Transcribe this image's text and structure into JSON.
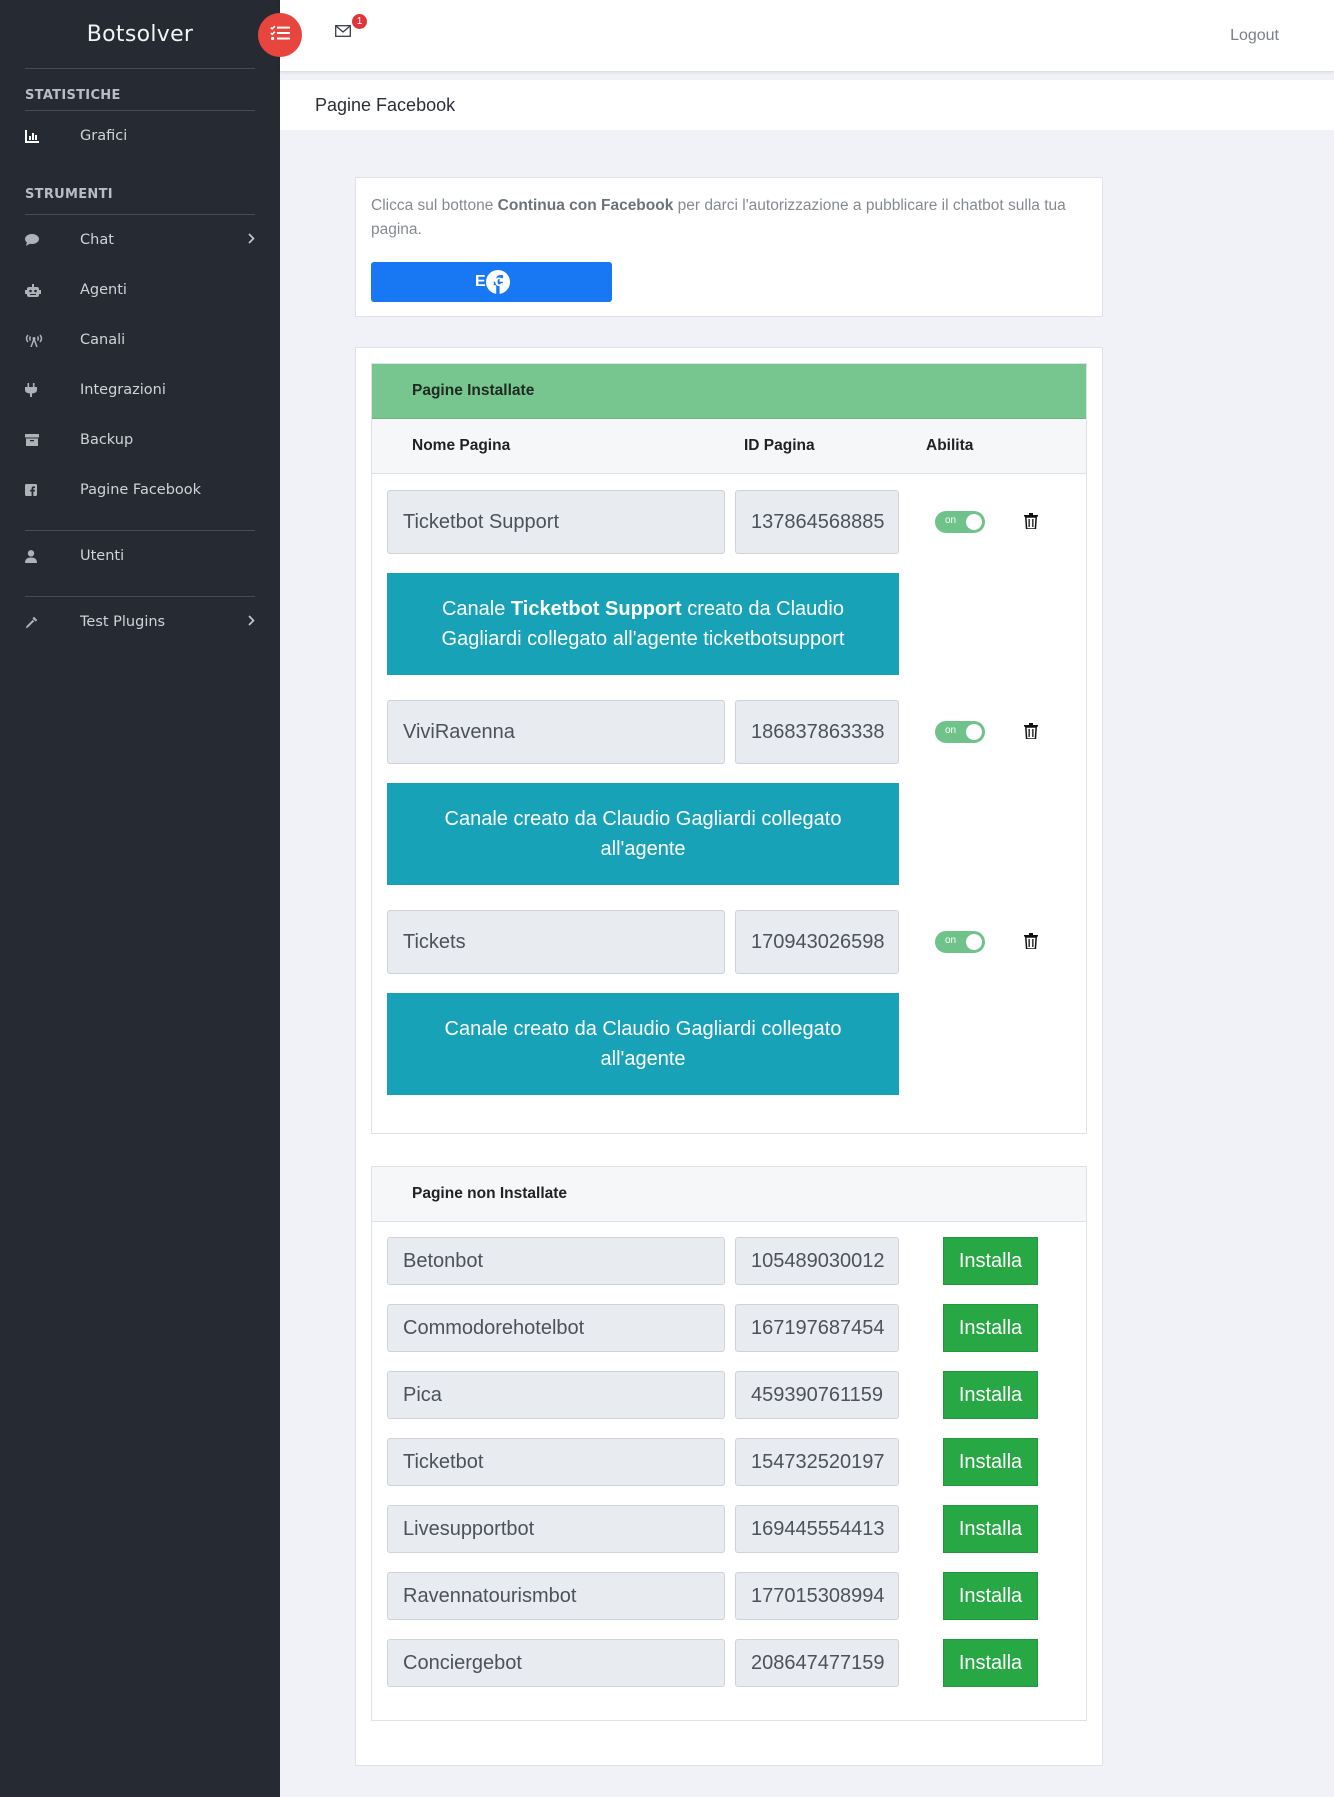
{
  "sidebar": {
    "brand": "Botsolver",
    "sections": {
      "stats": "STATISTICHE",
      "tools": "STRUMENTI"
    },
    "items": {
      "grafici": "Grafici",
      "chat": "Chat",
      "agenti": "Agenti",
      "canali": "Canali",
      "integrazioni": "Integrazioni",
      "backup": "Backup",
      "pagine_facebook": "Pagine Facebook",
      "utenti": "Utenti",
      "test_plugins": "Test Plugins"
    }
  },
  "topbar": {
    "mail_badge": "1",
    "logout": "Logout"
  },
  "page_title": "Pagine Facebook",
  "intro": {
    "text_before": "Clicca sul bottone ",
    "text_bold": "Continua con Facebook",
    "text_after": " per darci l'autorizzazione a pubblicare il chatbot sulla tua pagina.",
    "fb_button": "Esci"
  },
  "installed": {
    "title": "Pagine Installate",
    "columns": {
      "name": "Nome Pagina",
      "id": "ID Pagina",
      "enable": "Abilita"
    },
    "toggle_label": "on",
    "pages": [
      {
        "name": "Ticketbot Support",
        "id": "137864568885",
        "banner_before": "Canale ",
        "banner_bold": "Ticketbot Support",
        "banner_after": " creato da Claudio Gagliardi collegato all'agente ticketbotsupport"
      },
      {
        "name": "ViviRavenna",
        "id": "186837863338",
        "banner_before": "Canale creato da Claudio Gagliardi collegato all'agente",
        "banner_bold": "",
        "banner_after": ""
      },
      {
        "name": "Tickets",
        "id": "170943026598",
        "banner_before": "Canale creato da Claudio Gagliardi collegato all'agente",
        "banner_bold": "",
        "banner_after": ""
      }
    ]
  },
  "not_installed": {
    "title": "Pagine non Installate",
    "button_label": "Installa",
    "pages": [
      {
        "name": "Betonbot",
        "id": "105489030012"
      },
      {
        "name": "Commodorehotelbot",
        "id": "167197687454"
      },
      {
        "name": "Pica",
        "id": "459390761159"
      },
      {
        "name": "Ticketbot",
        "id": "154732520197"
      },
      {
        "name": "Livesupportbot",
        "id": "169445554413"
      },
      {
        "name": "Ravennatourismbot",
        "id": "177015308994"
      },
      {
        "name": "Conciergebot",
        "id": "208647477159"
      }
    ]
  }
}
